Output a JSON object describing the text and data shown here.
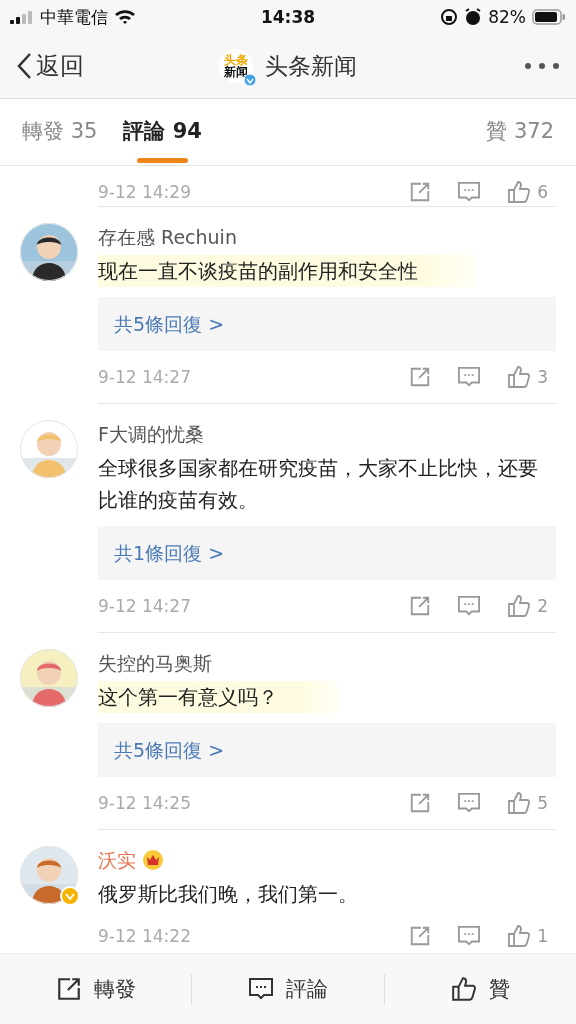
{
  "status_bar": {
    "carrier": "中華電信",
    "time": "14:38",
    "battery": "82%"
  },
  "nav": {
    "back": "返回",
    "logo": {
      "line_1": "头条",
      "line_2": "新闻",
      "verified": true
    },
    "title": "头条新闻"
  },
  "tabs": [
    {
      "label": "轉發 35",
      "selected": false
    },
    {
      "label": "評論 94",
      "selected": true
    },
    {
      "label": "贊 372",
      "selected": false
    }
  ],
  "top_partial": {
    "time": "9-12 14:29",
    "likes": "6"
  },
  "comments": [
    {
      "user": "存在感 Rechuin",
      "vip": false,
      "verified": false,
      "text": "现在一直不谈疫苗的副作用和安全性",
      "highlighted": true,
      "replies": "共5條回復 >",
      "time": "9-12 14:27",
      "likes": "3"
    },
    {
      "user": "F大调的忧桑",
      "vip": false,
      "verified": false,
      "text": "全球很多国家都在研究疫苗，大家不止比快，还要比谁的疫苗有效。",
      "highlighted": false,
      "replies": "共1條回復 >",
      "time": "9-12 14:27",
      "likes": "2"
    },
    {
      "user": "失控的马奥斯",
      "vip": false,
      "verified": false,
      "text": "这个第一有意义吗？",
      "highlighted": true,
      "replies": "共5條回復 >",
      "time": "9-12 14:25",
      "likes": "5"
    },
    {
      "user": "沃实",
      "vip": true,
      "verified": true,
      "text": "俄罗斯比我们晚，我们第一。",
      "highlighted": false,
      "time": "9-12 14:22",
      "likes": "1"
    }
  ],
  "footer": [
    {
      "kind": "share",
      "label": "轉發"
    },
    {
      "kind": "comment",
      "label": "評論"
    },
    {
      "kind": "like",
      "label": "贊"
    }
  ]
}
